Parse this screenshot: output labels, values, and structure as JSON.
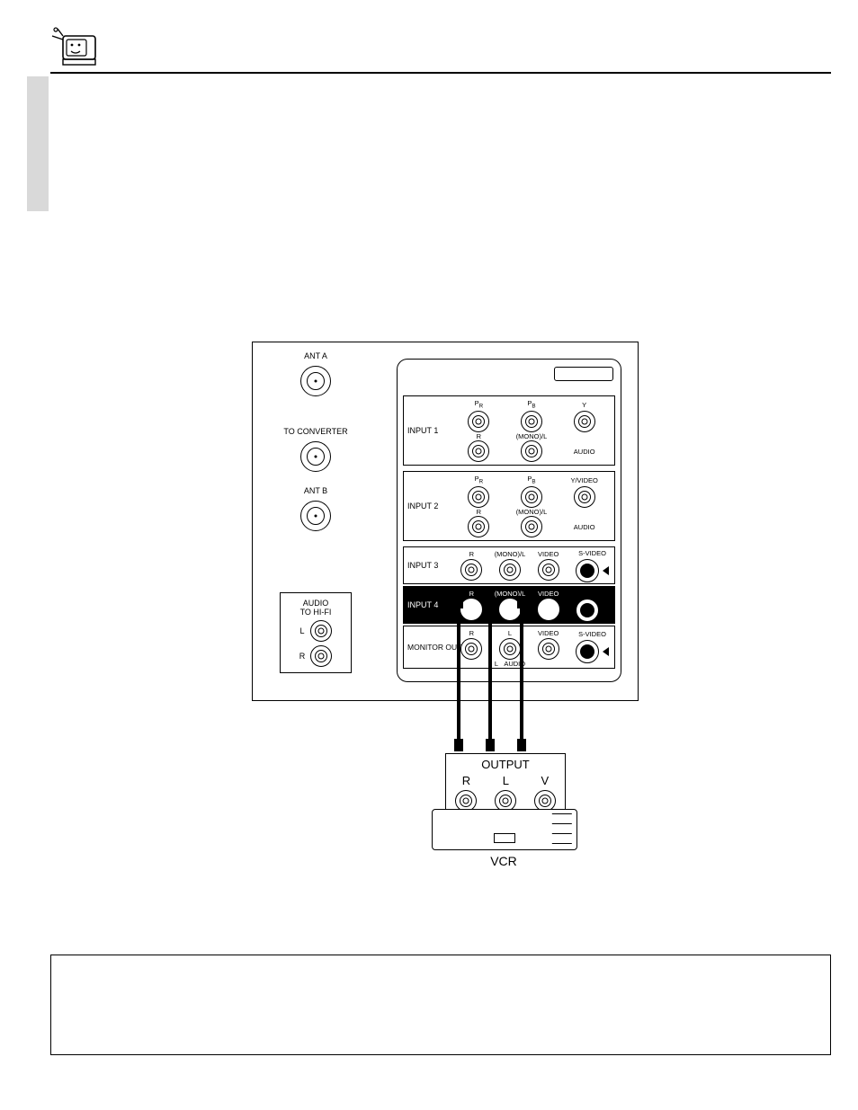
{
  "panel": {
    "ant_a": "ANT A",
    "to_converter": "TO CONVERTER",
    "ant_b": "ANT B",
    "hifi_title_1": "AUDIO",
    "hifi_title_2": "TO HI-FI",
    "hifi_l": "L",
    "hifi_r": "R",
    "input1": "INPUT 1",
    "input2": "INPUT 2",
    "input3": "INPUT 3",
    "input4": "INPUT 4",
    "monitor_out": "MONITOR OUT",
    "pr": "P",
    "pr_sub": "R",
    "pb": "P",
    "pb_sub": "B",
    "y": "Y",
    "yvideo": "Y/VIDEO",
    "r": "R",
    "monol": "(MONO)/L",
    "audio": "AUDIO",
    "video": "VIDEO",
    "svideo": "S-VIDEO",
    "l": "L"
  },
  "vcr": {
    "output": "OUTPUT",
    "r": "R",
    "l": "L",
    "v": "V",
    "label": "VCR"
  }
}
